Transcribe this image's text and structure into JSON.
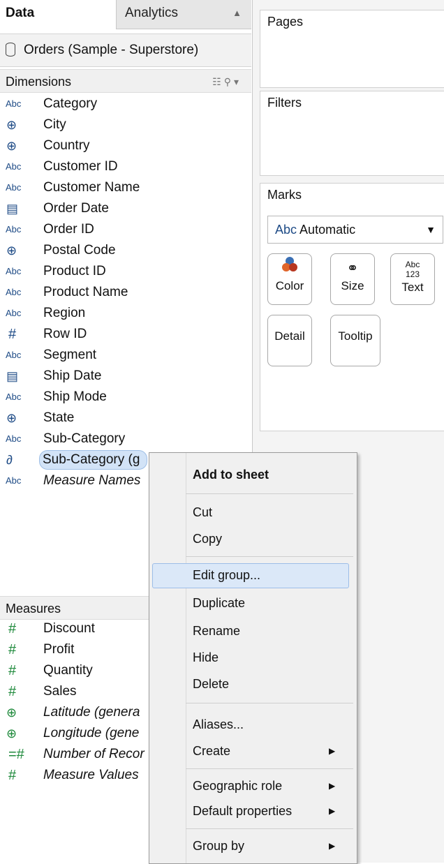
{
  "tabs": {
    "data": "Data",
    "analytics": "Analytics"
  },
  "datasource": "Orders (Sample - Superstore)",
  "dimensions_header": "Dimensions",
  "dimensions": [
    {
      "icon": "Abc",
      "label": "Category"
    },
    {
      "icon": "globe",
      "label": "City"
    },
    {
      "icon": "globe",
      "label": "Country"
    },
    {
      "icon": "Abc",
      "label": "Customer ID"
    },
    {
      "icon": "Abc",
      "label": "Customer Name"
    },
    {
      "icon": "calendar",
      "label": "Order Date"
    },
    {
      "icon": "Abc",
      "label": "Order ID"
    },
    {
      "icon": "globe",
      "label": "Postal Code"
    },
    {
      "icon": "Abc",
      "label": "Product ID"
    },
    {
      "icon": "Abc",
      "label": "Product Name"
    },
    {
      "icon": "Abc",
      "label": "Region"
    },
    {
      "icon": "#",
      "label": "Row ID"
    },
    {
      "icon": "Abc",
      "label": "Segment"
    },
    {
      "icon": "calendar",
      "label": "Ship Date"
    },
    {
      "icon": "Abc",
      "label": "Ship Mode"
    },
    {
      "icon": "globe",
      "label": "State"
    },
    {
      "icon": "Abc",
      "label": "Sub-Category"
    },
    {
      "icon": "paperclip",
      "label": "Sub-Category (g"
    },
    {
      "icon": "Abc",
      "label": "Measure Names"
    }
  ],
  "measures_header": "Measures",
  "measures": [
    {
      "icon": "#",
      "label": "Discount"
    },
    {
      "icon": "#",
      "label": "Profit"
    },
    {
      "icon": "#",
      "label": "Quantity"
    },
    {
      "icon": "#",
      "label": "Sales"
    },
    {
      "icon": "globe",
      "label": "Latitude (genera"
    },
    {
      "icon": "globe",
      "label": "Longitude (gene"
    },
    {
      "icon": "=#",
      "label": "Number of Recor"
    },
    {
      "icon": "#",
      "label": "Measure Values"
    }
  ],
  "shelves": {
    "pages": "Pages",
    "filters": "Filters",
    "marks": "Marks"
  },
  "marks": {
    "type_prefix": "Abc",
    "type": "Automatic",
    "buttons": {
      "color": "Color",
      "size": "Size",
      "text": "Text",
      "detail": "Detail",
      "tooltip": "Tooltip"
    },
    "text_glyph_top": "Abc",
    "text_glyph_bottom": "123"
  },
  "context_menu": {
    "add_to_sheet": "Add to sheet",
    "cut": "Cut",
    "copy": "Copy",
    "edit_group": "Edit group...",
    "duplicate": "Duplicate",
    "rename": "Rename",
    "hide": "Hide",
    "delete": "Delete",
    "aliases": "Aliases...",
    "create": "Create",
    "geographic_role": "Geographic role",
    "default_properties": "Default properties",
    "group_by": "Group by"
  }
}
